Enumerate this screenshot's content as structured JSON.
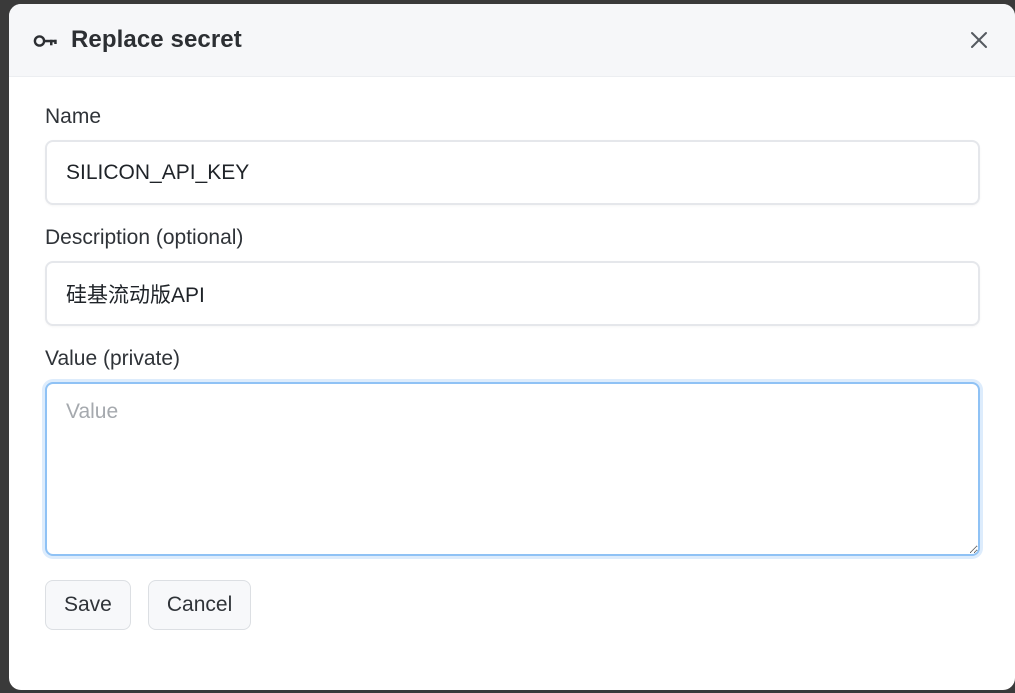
{
  "dialog": {
    "title": "Replace secret",
    "icon": "key-icon",
    "close_icon": "close-icon"
  },
  "form": {
    "name": {
      "label": "Name",
      "value": "SILICON_API_KEY"
    },
    "description": {
      "label": "Description (optional)",
      "value": "硅基流动版API"
    },
    "secret_value": {
      "label": "Value (private)",
      "placeholder": "Value",
      "value": ""
    }
  },
  "actions": {
    "save_label": "Save",
    "cancel_label": "Cancel"
  },
  "colors": {
    "focus_border": "#8fc2f5",
    "header_bg": "#f6f7f9"
  }
}
